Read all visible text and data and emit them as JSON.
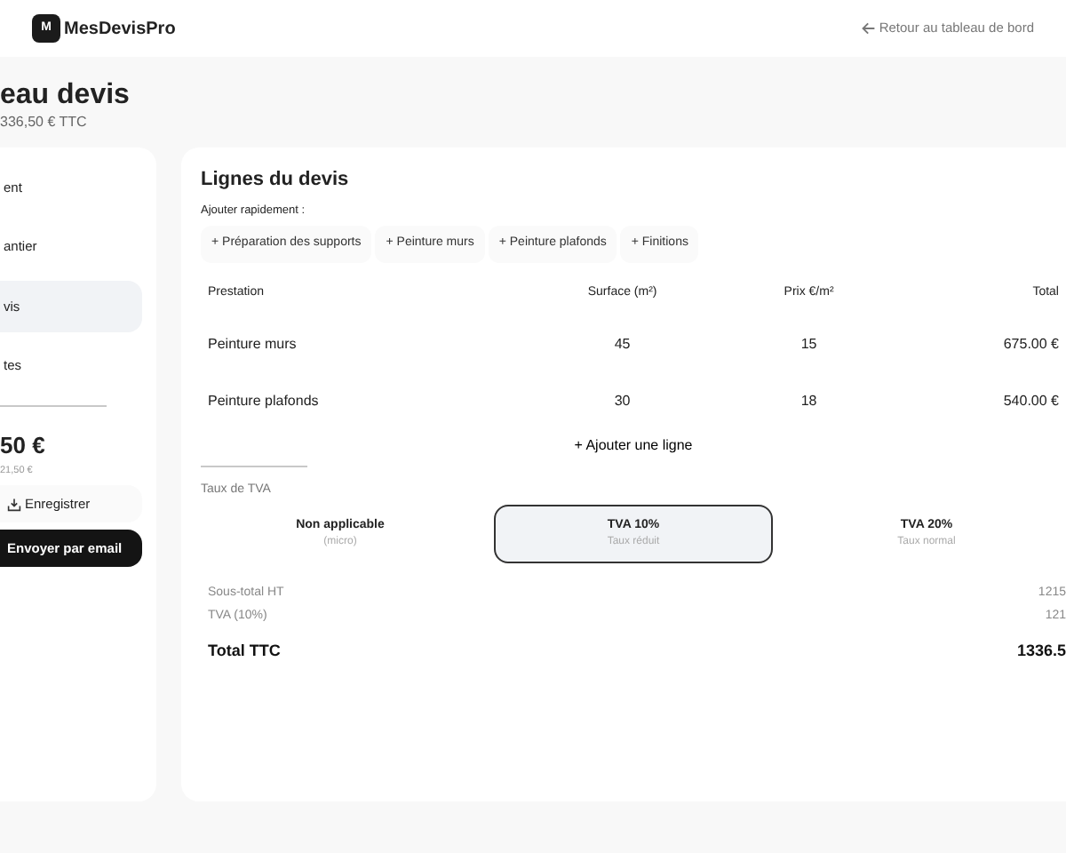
{
  "header": {
    "logo_letter": "M",
    "brand": "MesDevisPro",
    "back_link": "Retour au tableau de bord"
  },
  "page": {
    "title": "eau devis",
    "subtitle": "336,50 € TTC"
  },
  "sidebar": {
    "steps": [
      {
        "label": "ent",
        "selected": false
      },
      {
        "label": "antier",
        "selected": false
      },
      {
        "label": "vis",
        "selected": true
      },
      {
        "label": "tes",
        "selected": false
      }
    ],
    "total": "50 €",
    "total_sub": "21,50 €",
    "save_button": "Enregistrer",
    "send_button": "Envoyer par email"
  },
  "lines": {
    "title": "Lignes du devis",
    "quick_label": "Ajouter rapidement :",
    "quick_add": [
      "+ Préparation des supports",
      "+ Peinture murs",
      "+ Peinture plafonds",
      "+ Finitions"
    ],
    "columns": [
      "Prestation",
      "Surface (m²)",
      "Prix €/m²",
      "Total"
    ],
    "rows": [
      [
        "Peinture murs",
        "45",
        "15",
        "675.00 €"
      ],
      [
        "Peinture plafonds",
        "30",
        "18",
        "540.00 €"
      ]
    ],
    "add_line": "+ Ajouter une ligne"
  },
  "vat": {
    "label": "Taux de TVA",
    "options": [
      {
        "title": "Non applicable",
        "sub": "(micro)",
        "selected": false
      },
      {
        "title": "TVA 10%",
        "sub": "Taux réduit",
        "selected": true
      },
      {
        "title": "TVA 20%",
        "sub": "Taux normal",
        "selected": false
      }
    ]
  },
  "summary": [
    {
      "label": "Sous-total HT",
      "value": "1215",
      "kind": "minor"
    },
    {
      "label": "TVA (10%)",
      "value": "121",
      "kind": "minor"
    },
    {
      "label": "Total TTC",
      "value": "1336.5",
      "kind": "grand"
    }
  ]
}
